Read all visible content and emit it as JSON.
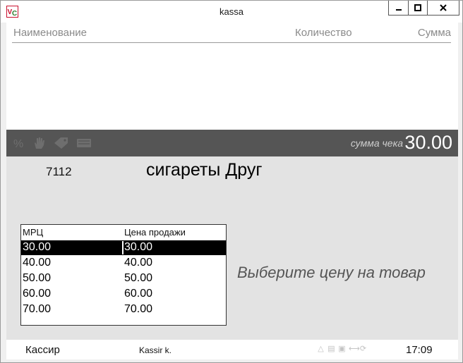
{
  "window": {
    "title": "kassa",
    "icon": "app-vc-icon"
  },
  "receipt": {
    "columns": {
      "name": "Наименование",
      "quantity": "Количество",
      "sum": "Сумма"
    }
  },
  "toolbar": {
    "icons": [
      "percent-icon",
      "hand-icon",
      "tag-icon",
      "keyboard-icon"
    ],
    "total_label": "сумма чека",
    "total_value": "30.00"
  },
  "product": {
    "code": "7112",
    "name": "сигареты Друг"
  },
  "price_table": {
    "headers": {
      "mrp": "МРЦ",
      "sale_price": "Цена продажи"
    },
    "rows": [
      {
        "mrp": "30.00",
        "sale_price": "30.00",
        "selected": true
      },
      {
        "mrp": "40.00",
        "sale_price": "40.00",
        "selected": false
      },
      {
        "mrp": "50.00",
        "sale_price": "50.00",
        "selected": false
      },
      {
        "mrp": "60.00",
        "sale_price": "60.00",
        "selected": false
      },
      {
        "mrp": "70.00",
        "sale_price": "70.00",
        "selected": false
      }
    ]
  },
  "hint": "Выберите цену на товар",
  "status": {
    "cashier_label": "Кассир",
    "cashier_name": "Kassir k.",
    "icons": [
      "drop-icon",
      "printer-icon",
      "card-icon",
      "network-icon",
      "sync-icon"
    ],
    "time": "17:09"
  },
  "colors": {
    "toolbar_bg": "#555555",
    "main_bg": "#e3e3e3",
    "selected_row": "#000000"
  }
}
